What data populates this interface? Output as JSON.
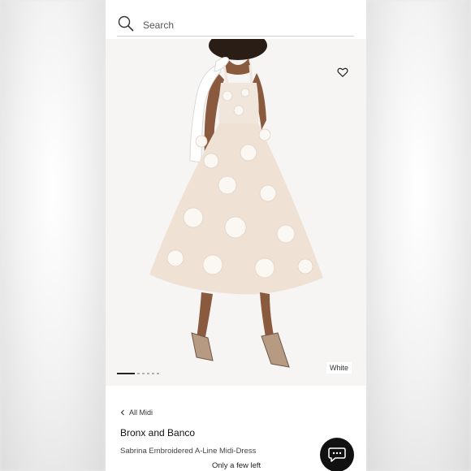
{
  "search": {
    "placeholder": "Search"
  },
  "product": {
    "color_label": "White",
    "back_link": "All Midi",
    "brand": "Bronx and Banco",
    "name": "Sabrina Embroidered A-Line Midi-Dress",
    "stock_status": "Only a few left"
  },
  "carousel": {
    "total_images": 6,
    "active_index": 0
  },
  "icons": {
    "search": "search-icon",
    "heart": "heart-icon",
    "back": "chevron-left-icon",
    "chat": "chat-icon"
  },
  "colors": {
    "chat_button": "#111111",
    "dress": "#f1e6db",
    "background": "#f6f5f4"
  }
}
